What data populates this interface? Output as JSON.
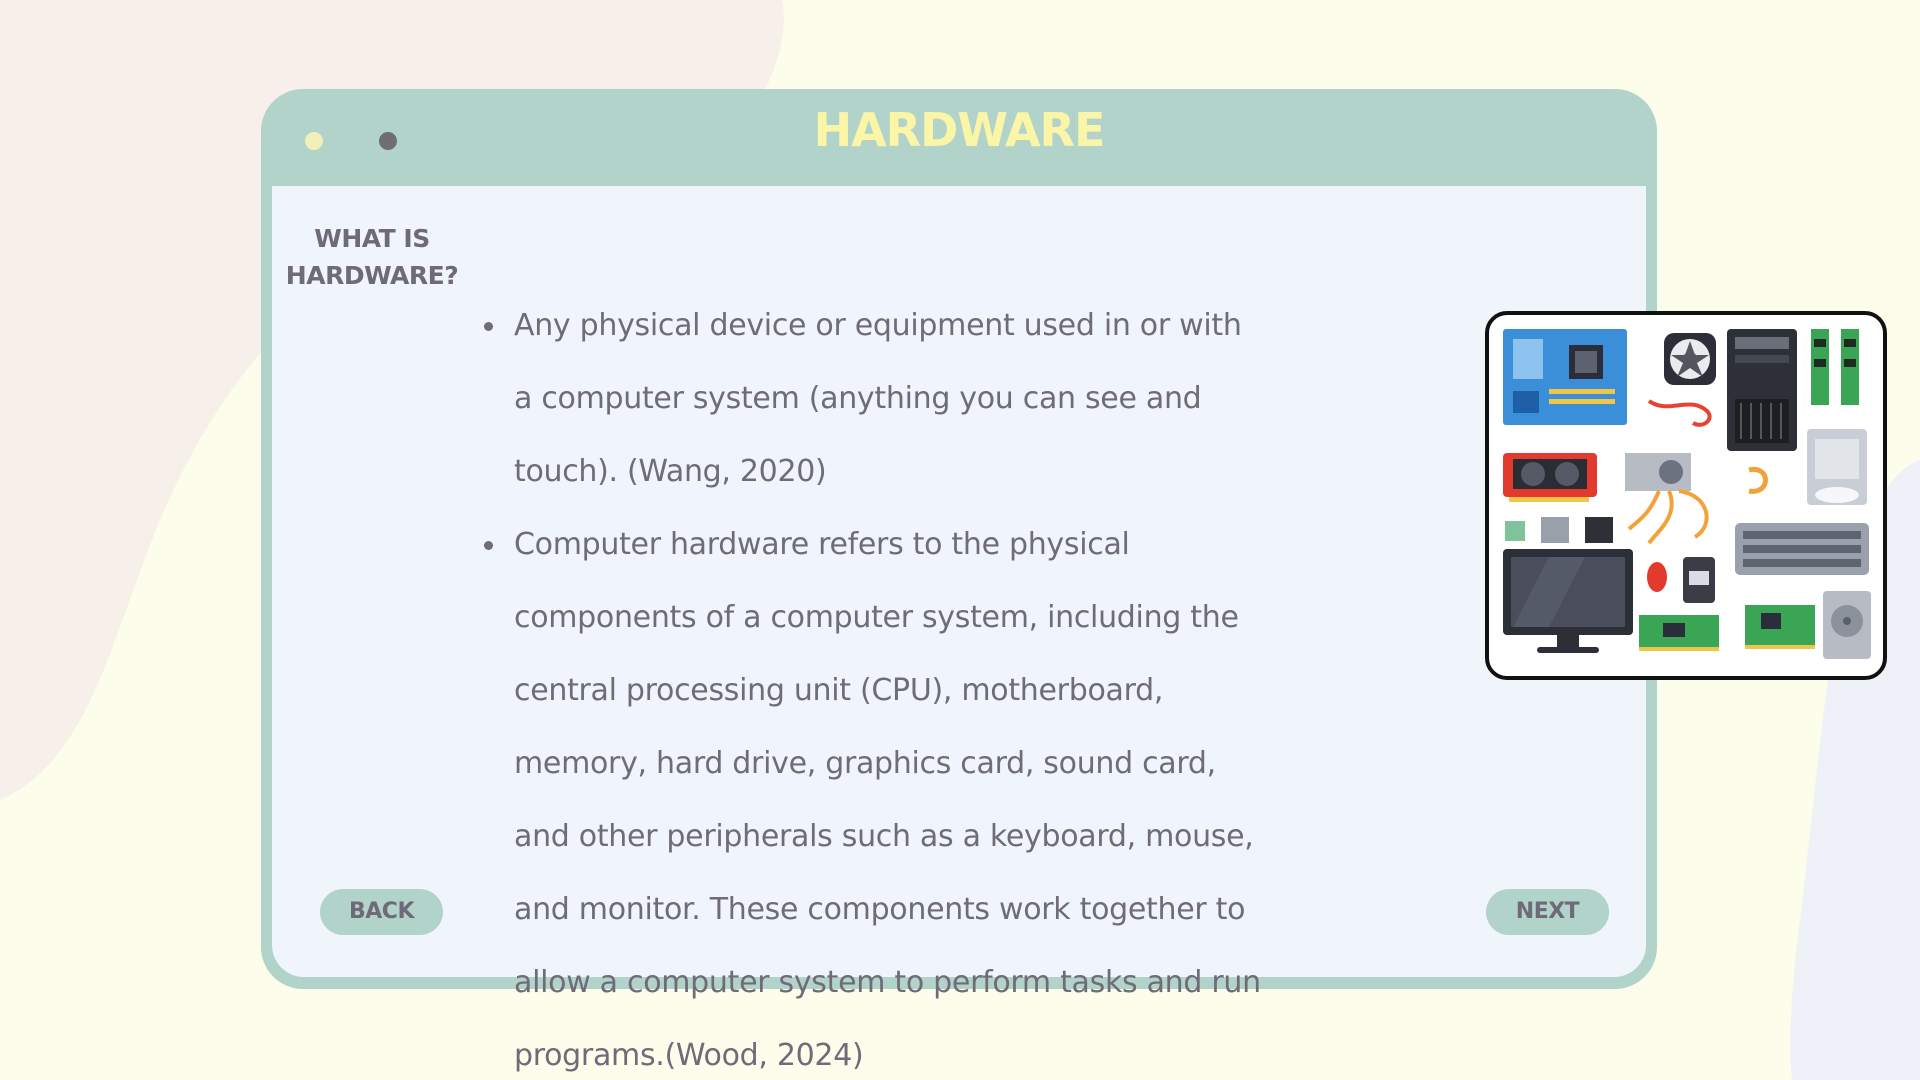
{
  "window": {
    "title": "HARDWARE"
  },
  "section": {
    "heading_line1": "WHAT IS",
    "heading_line2": "HARDWARE?"
  },
  "bullets": [
    "Any physical device or equipment used in or with a computer system (anything you can see and touch). (Wang, 2020)",
    "Computer hardware refers to the physical components of a computer system, including the central processing unit (CPU), motherboard, memory, hard drive, graphics card, sound card, and other peripherals such as a keyboard, mouse, and monitor. These components work together to allow a computer system to perform tasks and run programs.(Wood, 2024)"
  ],
  "nav": {
    "back_label": "BACK",
    "next_label": "NEXT"
  },
  "colors": {
    "background": "#fcfdeb",
    "window_frame": "#b2d3c9",
    "content_bg": "#f0f5fb",
    "title_text": "#fbf5a7",
    "body_text": "#6f6c78"
  },
  "image": {
    "icon": "computer-hardware-components-illustration"
  }
}
